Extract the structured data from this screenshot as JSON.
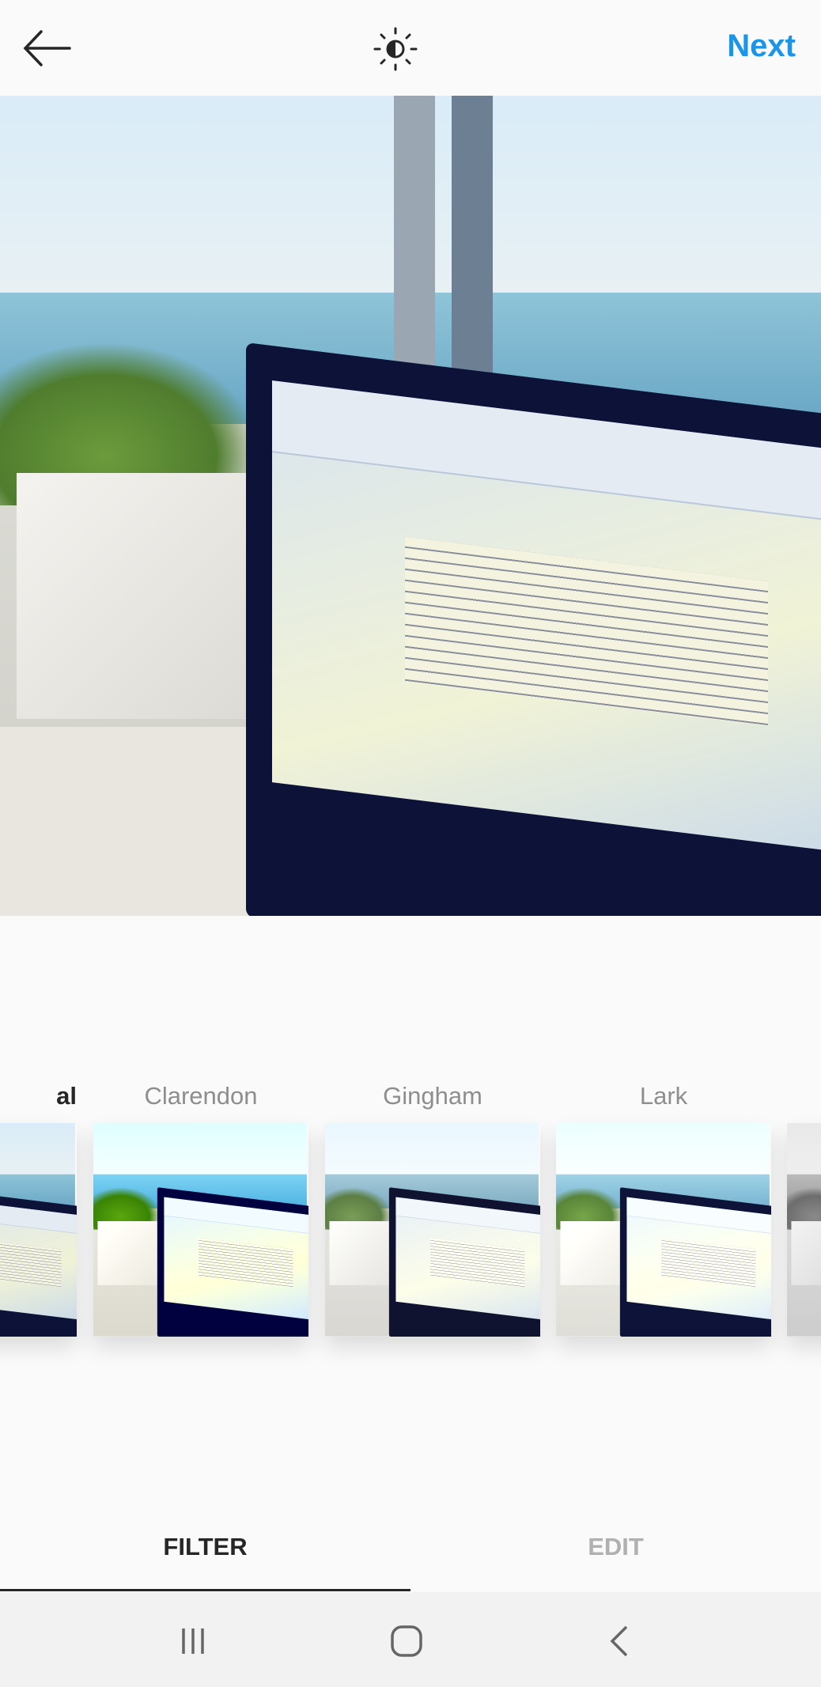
{
  "header": {
    "back_icon": "arrow-left-icon",
    "adjust_icon": "lux-sun-icon",
    "next_label": "Next",
    "next_color": "#1a95e8"
  },
  "photo": {
    "description_icon": "photo-preview"
  },
  "filters": [
    {
      "label": "Normal",
      "visible_label": "al",
      "selected": true
    },
    {
      "label": "Clarendon"
    },
    {
      "label": "Gingham"
    },
    {
      "label": "Lark"
    },
    {
      "label": ""
    }
  ],
  "tabs": [
    {
      "label": "FILTER",
      "active": true
    },
    {
      "label": "EDIT",
      "active": false
    }
  ],
  "navbar": {
    "recents_icon": "recents-icon",
    "home_icon": "home-icon",
    "back_icon": "back-chevron-icon"
  }
}
